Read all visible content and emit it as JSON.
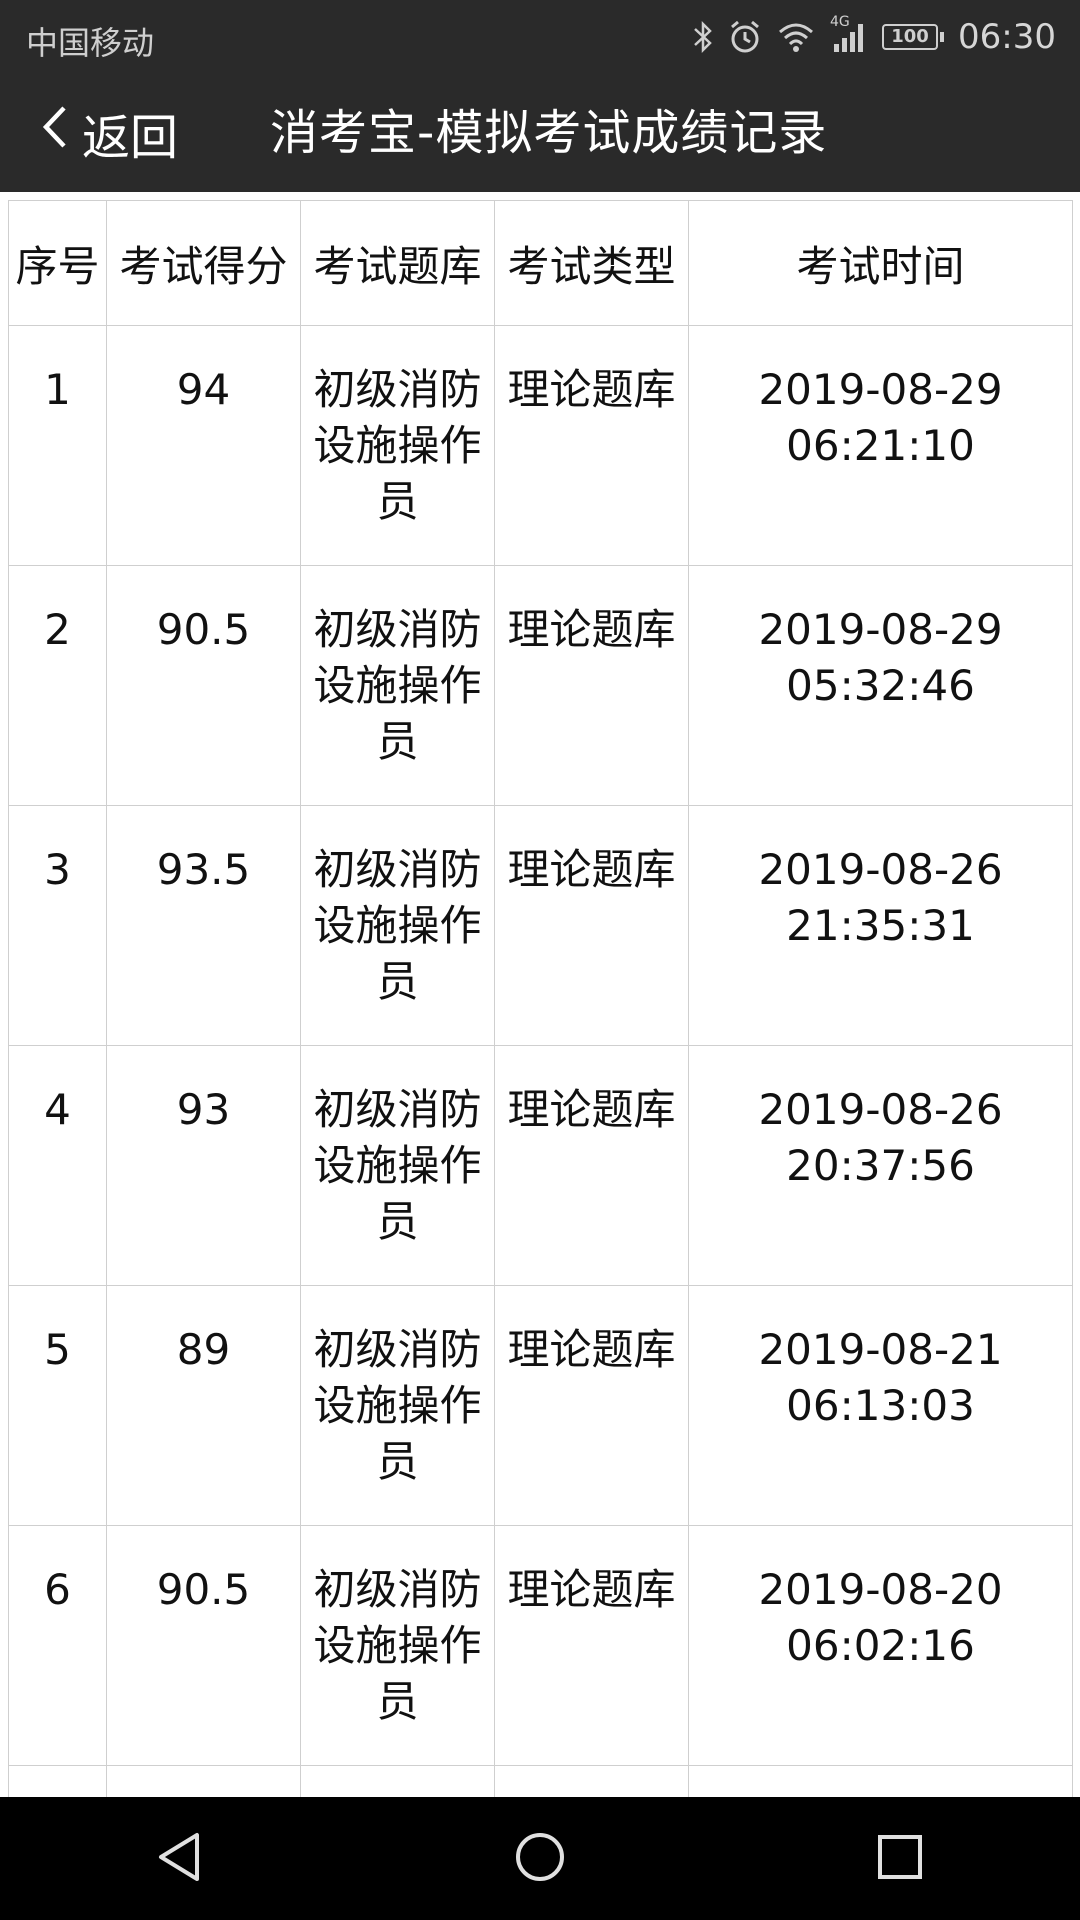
{
  "status_bar": {
    "carrier": "中国移动",
    "network": "4G",
    "battery": "100",
    "time": "06:30",
    "icons": [
      "bluetooth-icon",
      "alarm-icon",
      "wifi-icon",
      "signal-icon",
      "battery-icon"
    ]
  },
  "header": {
    "back_label": "返回",
    "title": "消考宝-模拟考试成绩记录"
  },
  "table": {
    "columns": [
      "序号",
      "考试得分",
      "考试题库",
      "考试类型",
      "考试时间"
    ],
    "rows": [
      {
        "no": "1",
        "score": "94",
        "bank": "初级消防设施操作员",
        "type": "理论题库",
        "date": "2019-08-29",
        "time": "06:21:10"
      },
      {
        "no": "2",
        "score": "90.5",
        "bank": "初级消防设施操作员",
        "type": "理论题库",
        "date": "2019-08-29",
        "time": "05:32:46"
      },
      {
        "no": "3",
        "score": "93.5",
        "bank": "初级消防设施操作员",
        "type": "理论题库",
        "date": "2019-08-26",
        "time": "21:35:31"
      },
      {
        "no": "4",
        "score": "93",
        "bank": "初级消防设施操作员",
        "type": "理论题库",
        "date": "2019-08-26",
        "time": "20:37:56"
      },
      {
        "no": "5",
        "score": "89",
        "bank": "初级消防设施操作员",
        "type": "理论题库",
        "date": "2019-08-21",
        "time": "06:13:03"
      },
      {
        "no": "6",
        "score": "90.5",
        "bank": "初级消防设施操作员",
        "type": "理论题库",
        "date": "2019-08-20",
        "time": "06:02:16"
      }
    ]
  },
  "nav_bar": {
    "buttons": [
      "back-nav-icon",
      "home-nav-icon",
      "recents-nav-icon"
    ]
  },
  "colors": {
    "bar_background": "#2a2a2a",
    "table_border": "#cfcfcf",
    "nav_background": "#000000"
  }
}
